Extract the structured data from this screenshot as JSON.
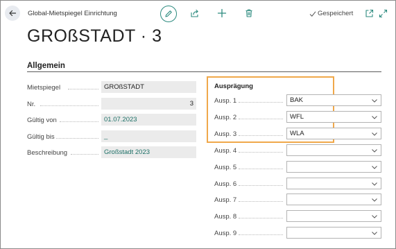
{
  "header": {
    "breadcrumb": "Global-Mietspiegel Einrichtung",
    "saved_status": "Gespeichert"
  },
  "page": {
    "title": "GROßSTADT · 3"
  },
  "general": {
    "section_title": "Allgemein",
    "fields": [
      {
        "label": "Mietspiegel",
        "value": "GROßSTADT"
      },
      {
        "label": "Nr.",
        "value": "3"
      },
      {
        "label": "Gültig von",
        "value": "01.07.2023"
      },
      {
        "label": "Gültig bis",
        "value": "_"
      },
      {
        "label": "Beschreibung",
        "value": "Großstadt 2023"
      }
    ]
  },
  "auspraegung": {
    "group_title": "Ausprägung",
    "rows": [
      {
        "label": "Ausp. 1",
        "value": "BAK"
      },
      {
        "label": "Ausp. 2",
        "value": "WFL"
      },
      {
        "label": "Ausp. 3",
        "value": "WLA"
      },
      {
        "label": "Ausp. 4",
        "value": ""
      },
      {
        "label": "Ausp. 5",
        "value": ""
      },
      {
        "label": "Ausp. 6",
        "value": ""
      },
      {
        "label": "Ausp. 7",
        "value": ""
      },
      {
        "label": "Ausp. 8",
        "value": ""
      },
      {
        "label": "Ausp. 9",
        "value": ""
      }
    ]
  },
  "colors": {
    "accent": "#2b8a7e",
    "link": "#1c6f66",
    "highlight_border": "#f0a84a",
    "field_bg": "#ebebeb"
  },
  "icons": [
    "back-arrow-icon",
    "pencil-icon",
    "share-icon",
    "plus-icon",
    "trash-icon",
    "checkmark-icon",
    "popout-icon",
    "expand-icon",
    "chevron-down-icon"
  ]
}
